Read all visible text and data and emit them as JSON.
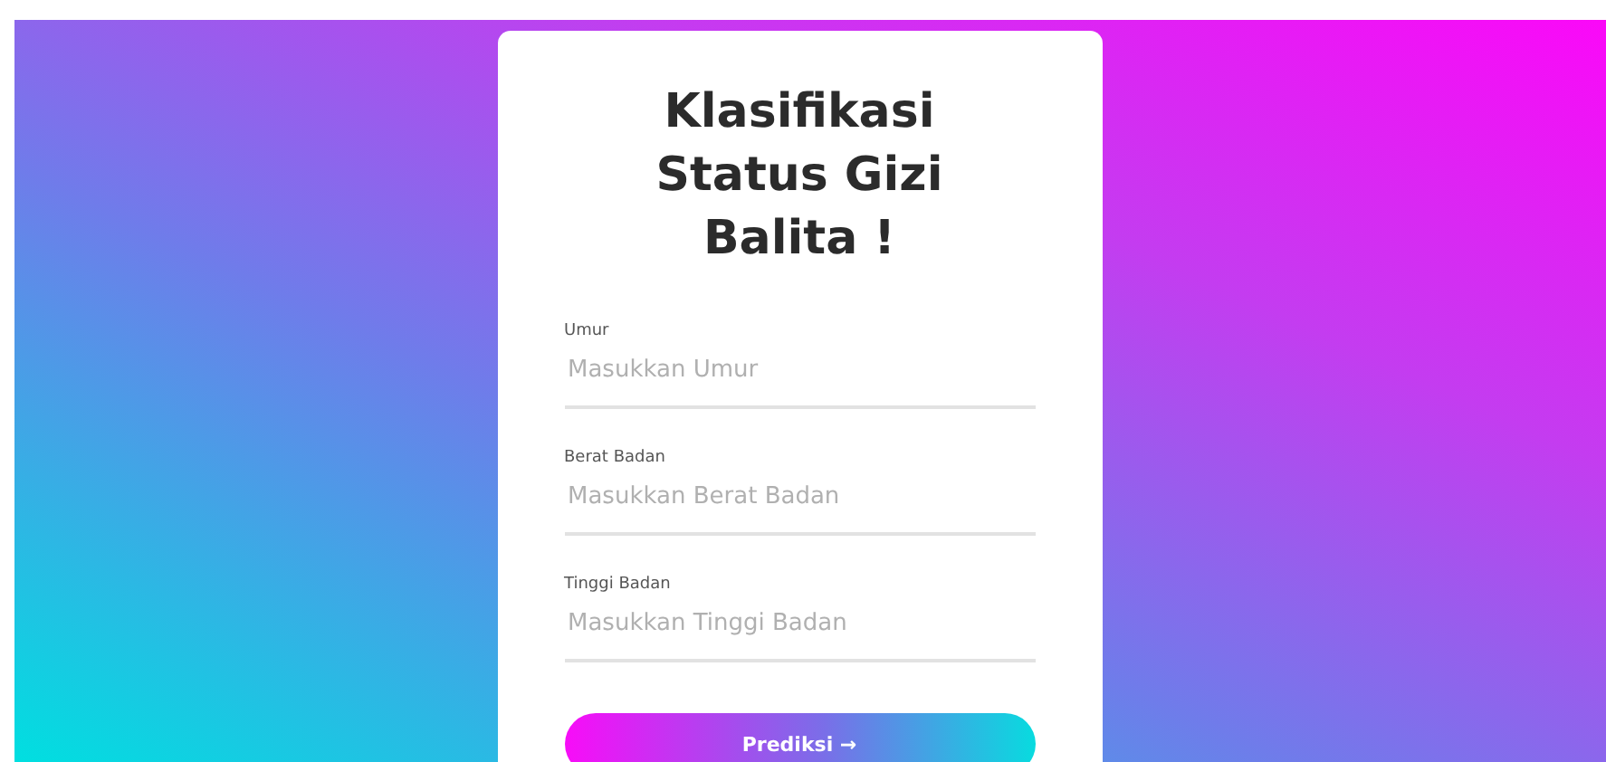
{
  "title": "Klasifikasi Status Gizi Balita !",
  "fields": [
    {
      "label": "Umur",
      "placeholder": "Masukkan Umur"
    },
    {
      "label": "Berat Badan",
      "placeholder": "Masukkan Berat Badan"
    },
    {
      "label": "Tinggi Badan",
      "placeholder": "Masukkan Tinggi Badan"
    }
  ],
  "submit_button": {
    "label": "Prediksi →"
  }
}
